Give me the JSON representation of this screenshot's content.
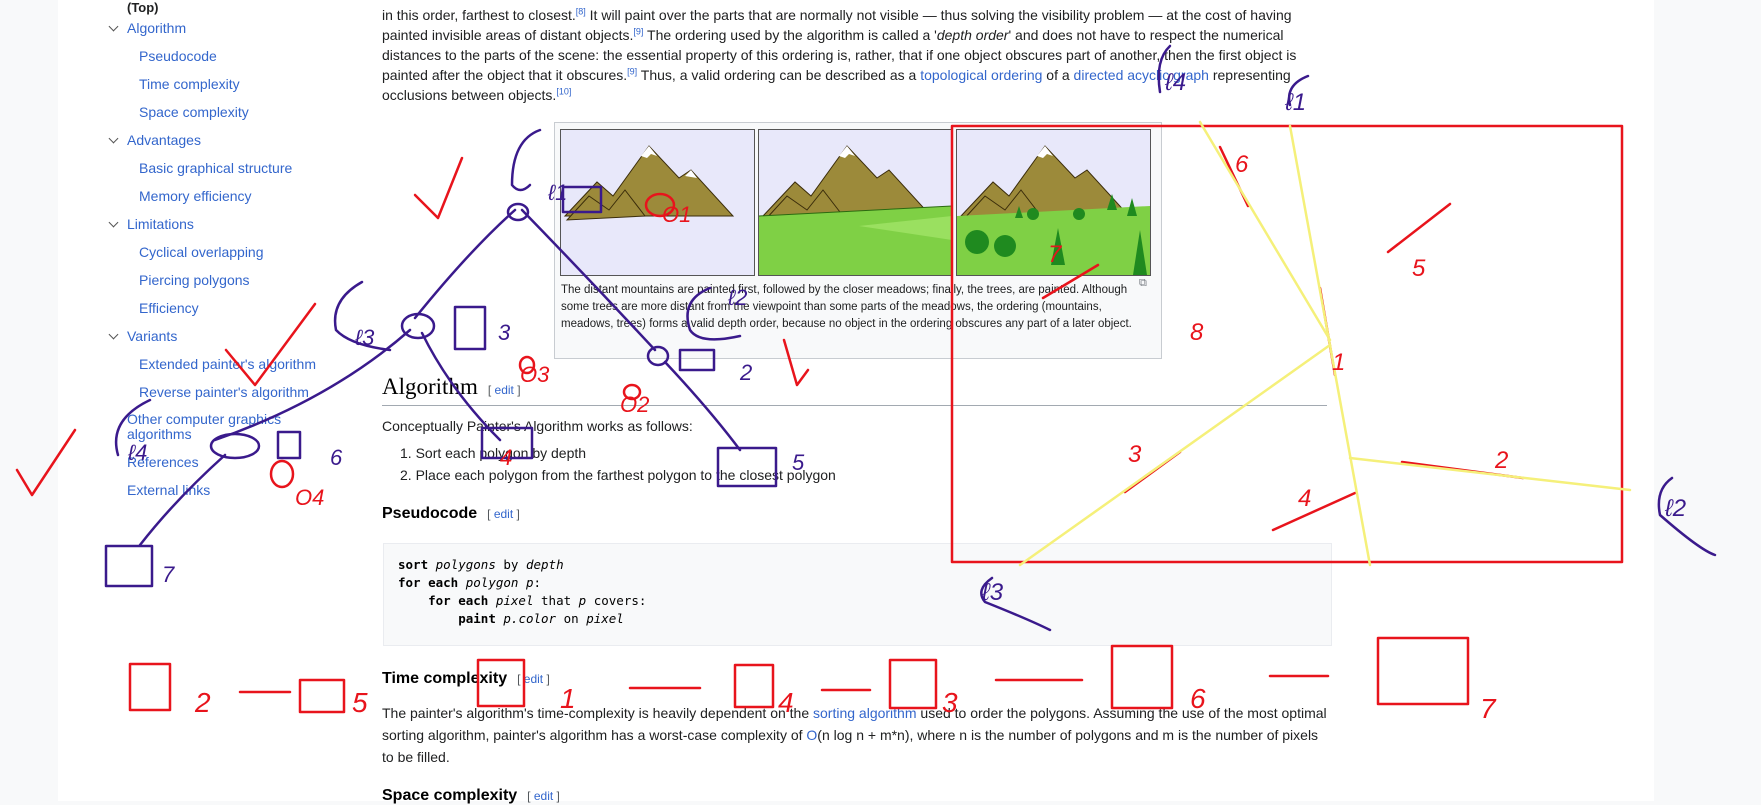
{
  "toc": {
    "top_label": "(Top)",
    "items": [
      {
        "label": "Algorithm",
        "level": 1,
        "collapsible": true
      },
      {
        "label": "Pseudocode",
        "level": 2
      },
      {
        "label": "Time complexity",
        "level": 2
      },
      {
        "label": "Space complexity",
        "level": 2
      },
      {
        "label": "Advantages",
        "level": 1,
        "collapsible": true
      },
      {
        "label": "Basic graphical structure",
        "level": 2
      },
      {
        "label": "Memory efficiency",
        "level": 2
      },
      {
        "label": "Limitations",
        "level": 1,
        "collapsible": true
      },
      {
        "label": "Cyclical overlapping",
        "level": 2
      },
      {
        "label": "Piercing polygons",
        "level": 2
      },
      {
        "label": "Efficiency",
        "level": 2
      },
      {
        "label": "Variants",
        "level": 1,
        "collapsible": true
      },
      {
        "label": "Extended painter's algorithm",
        "level": 2
      },
      {
        "label": "Reverse painter's algorithm",
        "level": 2
      },
      {
        "label": "Other computer graphics algorithms",
        "level": 1
      },
      {
        "label": "References",
        "level": 1
      },
      {
        "label": "External links",
        "level": 1
      }
    ]
  },
  "intro": {
    "line1_a": "in this order, farthest to closest.",
    "line1_sup": "[8]",
    "line1_b": " It will paint over the parts that are normally not visible — thus solving the visibility problem — at the cost of having",
    "line2_a": "painted invisible areas of distant objects.",
    "line2_sup": "[9]",
    "line2_b": " The ordering used by the algorithm is called a '",
    "line2_em": "depth order",
    "line2_c": "' and does not have to respect the numerical",
    "line3": "distances to the parts of the scene: the essential property of this ordering is, rather, that if one object obscures part of another, then the first object is",
    "line4_a": "painted after the object that it obscures.",
    "line4_sup": "[9]",
    "line4_b": " Thus, a valid ordering can be described as a ",
    "line4_link1": "topological ordering",
    "line4_c": " of a ",
    "line4_link2": "directed acyclic graph",
    "line4_d": " representing",
    "line5_a": "occlusions between objects.",
    "line5_sup": "[10]"
  },
  "figure": {
    "caption": "The distant mountains are painted first, followed by the closer meadows; finally, the trees, are painted. Although some trees are more distant from the viewpoint than some parts of the meadows, the ordering (mountains, meadows, trees) forms a valid depth order, because no object in the ordering obscures any part of a later object.",
    "colors": {
      "sky": "#e8e8fa",
      "mountain": "#9c8a3a",
      "snow": "#ffffff",
      "meadow": "#7fd045",
      "tree": "#1f8a1f"
    }
  },
  "algorithm": {
    "heading": "Algorithm",
    "edit": "edit",
    "intro": "Conceptually Painter's Algorithm works as follows:",
    "steps": [
      "Sort each polygon by depth",
      "Place each polygon from the farthest polygon to the closest polygon"
    ]
  },
  "pseudocode": {
    "heading": "Pseudocode",
    "edit": "edit",
    "lines": [
      [
        "sort",
        " ",
        "polygons",
        " by ",
        "depth"
      ],
      [
        "for each",
        " ",
        "polygon",
        " ",
        "p",
        ":"
      ],
      [
        "for each",
        " ",
        "pixel",
        " that ",
        "p",
        " covers:"
      ],
      [
        "paint",
        " ",
        "p.color",
        " on ",
        "pixel"
      ]
    ]
  },
  "time_complexity": {
    "heading": "Time complexity",
    "edit": "edit",
    "text_a": "The painter's algorithm's time-complexity is heavily dependent on the ",
    "link1": "sorting algorithm",
    "text_b": " used to order the polygons. Assuming the use of the most optimal",
    "text_c": "sorting algorithm, painter's algorithm has a worst-case complexity of ",
    "link2": "O",
    "text_d": "(n log n + m*n), where n is the number of polygons and m is the number of pixels",
    "text_e": "to be filled."
  },
  "space_complexity": {
    "heading": "Space complexity",
    "edit": "edit"
  },
  "annotations": {
    "ink_red": "#e8141c",
    "ink_purple": "#3a1a8c",
    "ink_yellow": "#f5f07a",
    "tree_labels": [
      "ℓ1",
      "O1",
      "ℓ3",
      "3",
      "O3",
      "ℓ2",
      "O2",
      "2",
      "ℓ4",
      "6",
      "O4",
      "4",
      "5",
      "7"
    ],
    "diagram_labels": [
      "ℓ4",
      "ℓ1",
      "6",
      "5",
      "7",
      "1",
      "3",
      "2",
      "4",
      "ℓ2",
      "ℓ3",
      "8"
    ],
    "order_labels": [
      "2",
      "5",
      "1",
      "4",
      "3",
      "6",
      "7"
    ]
  }
}
